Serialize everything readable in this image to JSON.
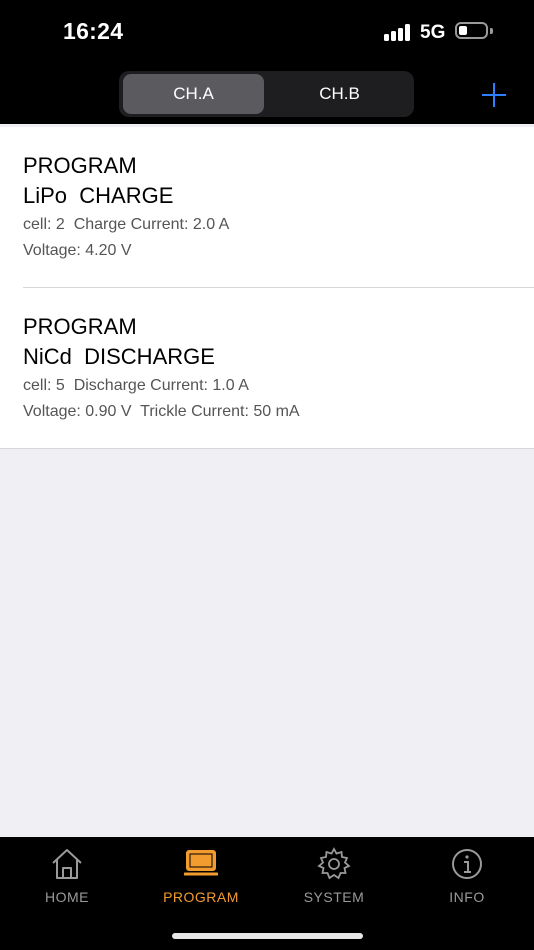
{
  "status_bar": {
    "time": "16:24",
    "network": "5G"
  },
  "header": {
    "segments": [
      "CH.A",
      "CH.B"
    ],
    "selected_segment": "CH.A",
    "add_icon": "plus-icon",
    "accent_color": "#2f80ff"
  },
  "programs": [
    {
      "label": "PROGRAM",
      "title": "LiPo  CHARGE",
      "detail1": "cell: 2  Charge Current: 2.0 A",
      "detail2": "Voltage: 4.20 V"
    },
    {
      "label": "PROGRAM",
      "title": "NiCd  DISCHARGE",
      "detail1": "cell: 5  Discharge Current: 1.0 A",
      "detail2": "Voltage: 0.90 V  Trickle Current: 50 mA"
    }
  ],
  "tabbar": {
    "active_color": "#f29b2e",
    "items": [
      {
        "label": "HOME",
        "icon": "home-icon"
      },
      {
        "label": "PROGRAM",
        "icon": "laptop-icon"
      },
      {
        "label": "SYSTEM",
        "icon": "gear-icon"
      },
      {
        "label": "INFO",
        "icon": "info-icon"
      }
    ]
  }
}
